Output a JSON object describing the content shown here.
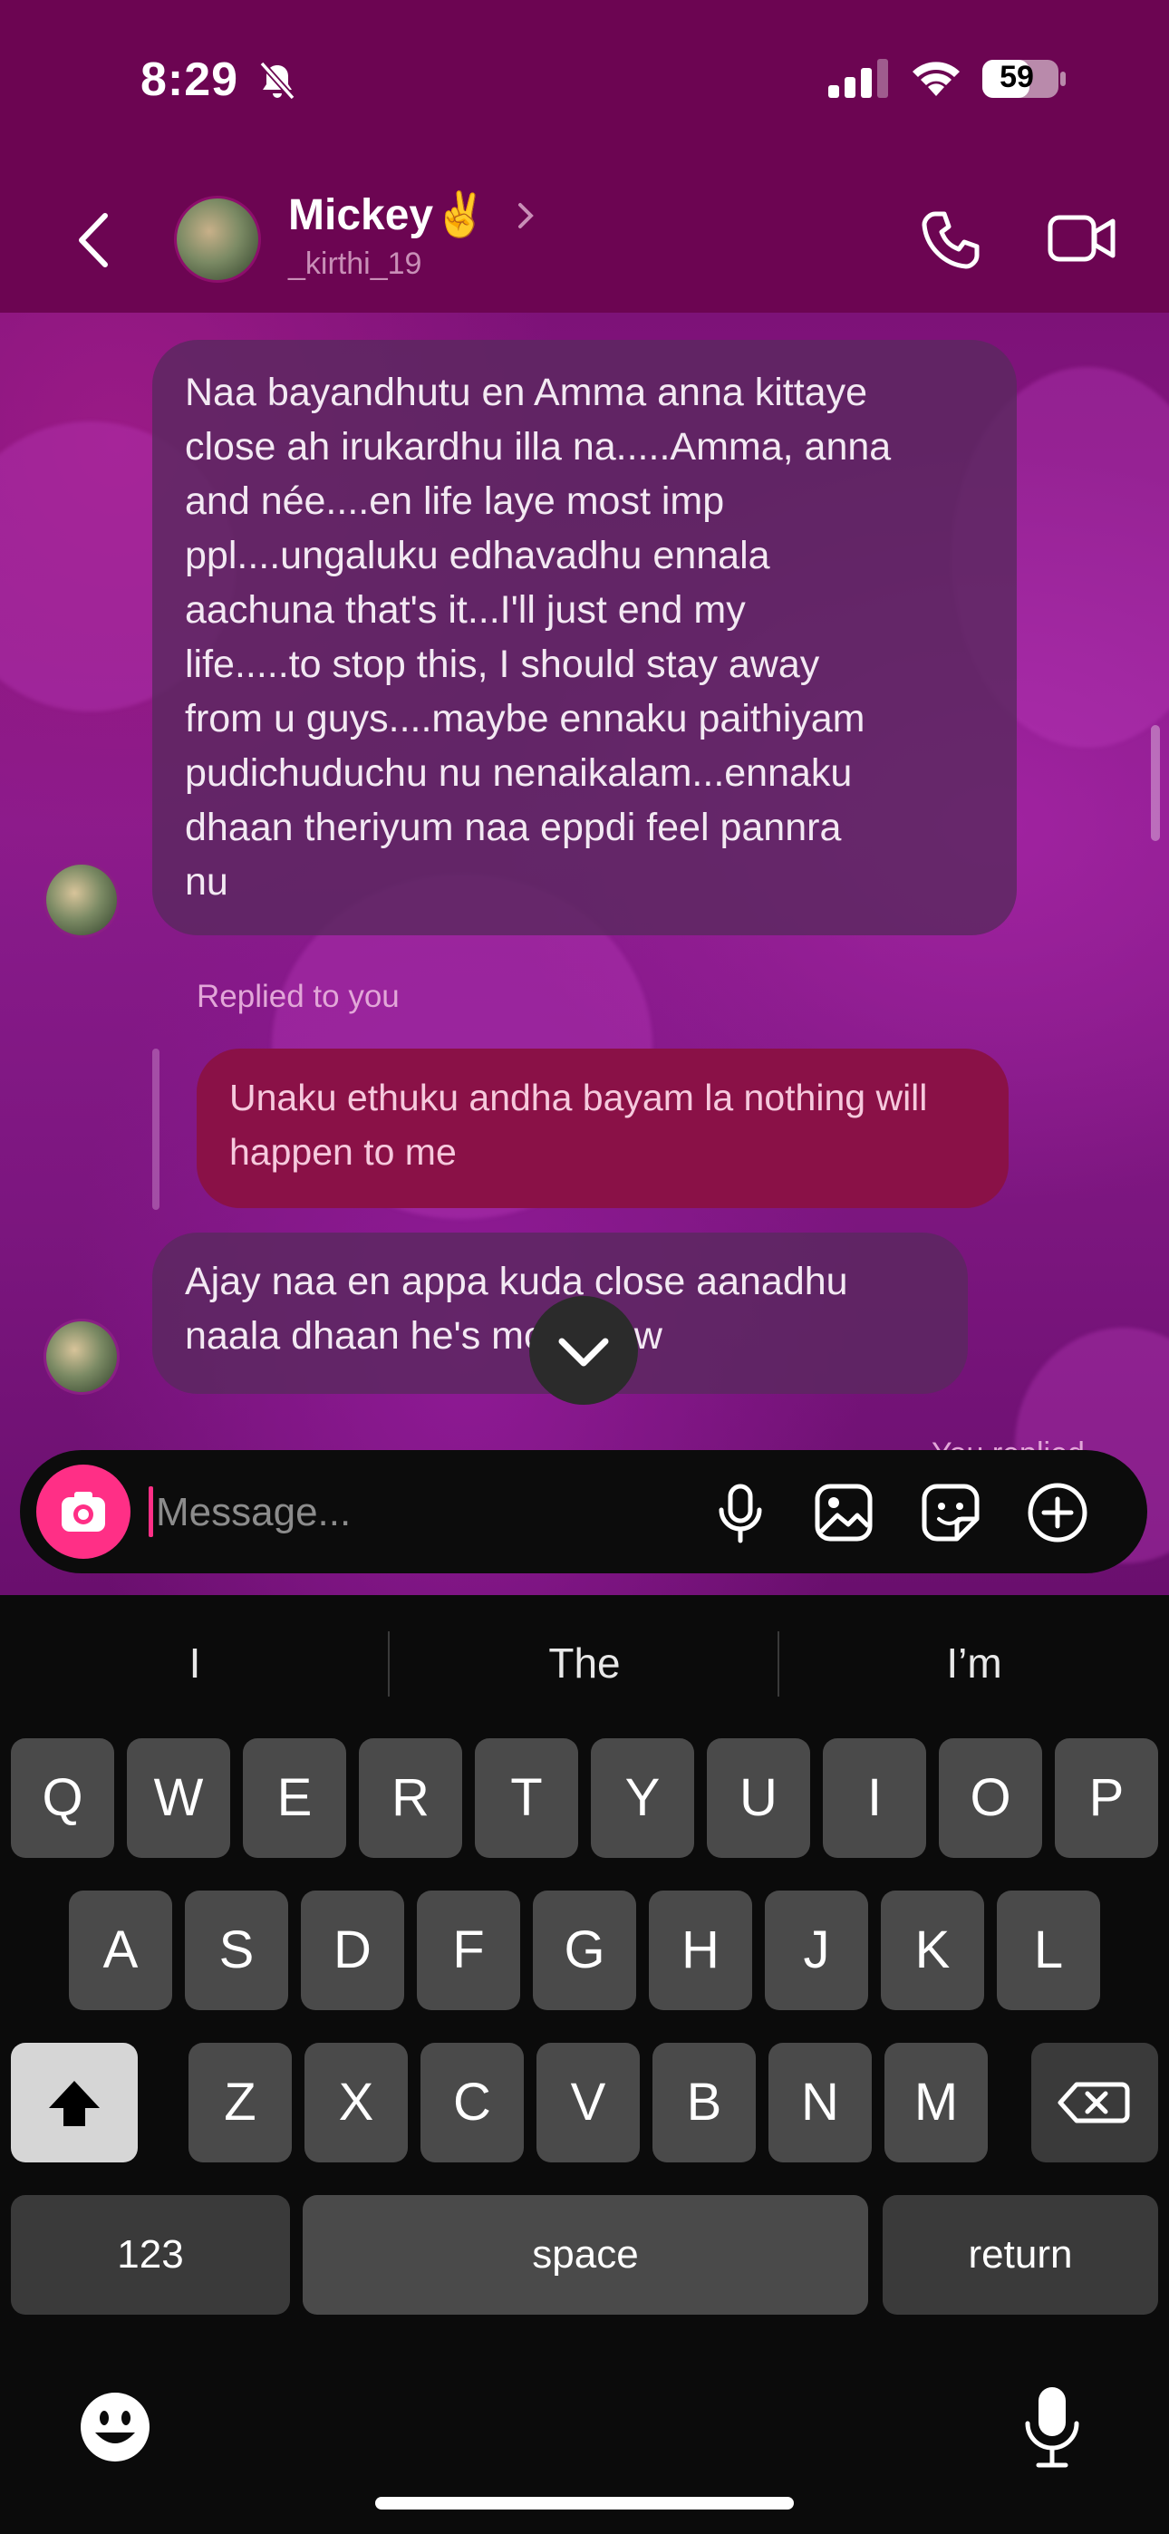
{
  "status": {
    "time": "8:29",
    "battery": "59",
    "icons": [
      "bell-slash-icon",
      "cellular-signal-icon",
      "wifi-icon",
      "battery-icon"
    ]
  },
  "header": {
    "name": "Mickey✌️",
    "username": "_kirthi_19",
    "icons": [
      "back-chevron-icon",
      "avatar",
      "chevron-right-icon",
      "phone-icon",
      "video-icon"
    ]
  },
  "messages": [
    {
      "sender": "them",
      "lines": [
        "Naa bayandhutu en Amma anna  kittaye",
        "close ah irukardhu illa na.....Amma, anna",
        "and née....en life laye most imp",
        "ppl....ungaluku edhavadhu ennala",
        "aachuna that's it...I'll just end my",
        "life.....to stop this, I should stay away",
        "from u guys....maybe ennaku paithiyam",
        "pudichuduchu nu nenaikalam...ennaku",
        "dhaan theriyum naa eppdi feel pannra",
        "nu"
      ]
    },
    {
      "sender": "me",
      "reply_label": "Replied to you",
      "lines": [
        "Unaku ethuku andha bayam la nothing will",
        "happen to me"
      ]
    },
    {
      "sender": "them",
      "lines": [
        "Ajay naa en appa kuda close aanadhu",
        "naala dhaan he's more now"
      ]
    }
  ],
  "you_replied": "You replied",
  "composer": {
    "placeholder": "Message...",
    "icons": [
      "camera-icon",
      "microphone-icon",
      "image-icon",
      "sticker-icon",
      "plus-icon"
    ]
  },
  "keyboard": {
    "suggestions": [
      "I",
      "The",
      "I’m"
    ],
    "row1": [
      "Q",
      "W",
      "E",
      "R",
      "T",
      "Y",
      "U",
      "I",
      "O",
      "P"
    ],
    "row2": [
      "A",
      "S",
      "D",
      "F",
      "G",
      "H",
      "J",
      "K",
      "L"
    ],
    "row3": [
      "Z",
      "X",
      "C",
      "V",
      "B",
      "N",
      "M"
    ],
    "numbers": "123",
    "space": "space",
    "return": "return",
    "icons": [
      "shift-icon",
      "delete-icon",
      "emoji-icon",
      "dictation-mic-icon"
    ]
  },
  "colors": {
    "header_bg": "#6c0552",
    "accent": "#ff2f86",
    "outgoing_bubble": "#8a1147",
    "incoming_bubble": "#5a285f"
  }
}
